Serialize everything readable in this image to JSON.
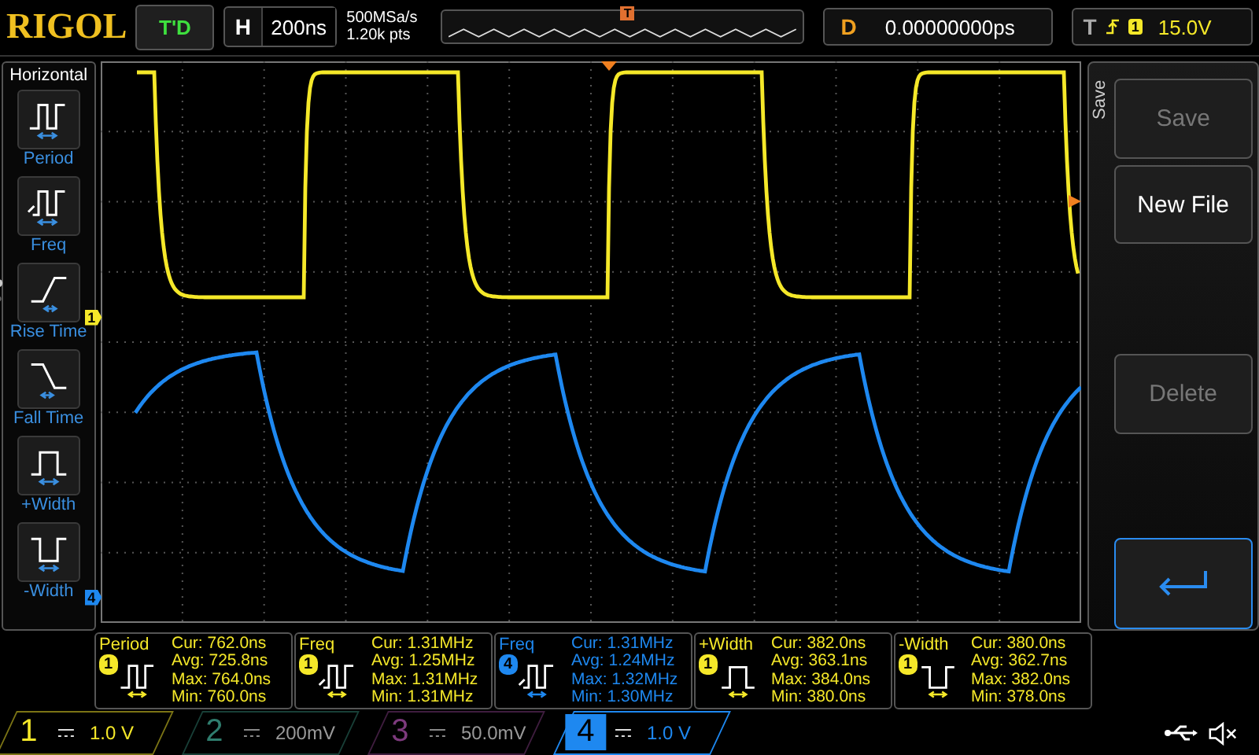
{
  "header": {
    "logo": "RIGOL",
    "run_status": "T'D",
    "horizontal": {
      "label": "H",
      "value": "200ns"
    },
    "sample_rate": "500MSa/s",
    "memory_depth": "1.20k pts",
    "overview_marker": "T",
    "delay": {
      "label": "D",
      "value": "0.00000000ps"
    },
    "trigger": {
      "label": "T",
      "source": "1",
      "level": "15.0V"
    }
  },
  "menu": {
    "title": "Horizontal",
    "items": [
      {
        "kind": "period",
        "label": "Period"
      },
      {
        "kind": "freq",
        "label": "Freq"
      },
      {
        "kind": "rise",
        "label": "Rise Time"
      },
      {
        "kind": "fall",
        "label": "Fall Time"
      },
      {
        "kind": "pwidth",
        "label": "+Width"
      },
      {
        "kind": "nwidth",
        "label": "-Width"
      }
    ]
  },
  "channel_markers": [
    {
      "label": "1",
      "color": "#f5e829"
    },
    {
      "label": "4",
      "color": "#1e88f0"
    }
  ],
  "side_panel": {
    "title": "Save",
    "buttons": [
      {
        "label": "Save",
        "disabled": true
      },
      {
        "label": "New File",
        "disabled": false
      },
      {
        "label": "Delete",
        "disabled": true
      }
    ]
  },
  "measurements": [
    {
      "name": "Period",
      "kind": "period",
      "channel": "1",
      "color": "#f5e829",
      "rows": [
        "Cur: 762.0ns",
        "Avg: 725.8ns",
        "Max: 764.0ns",
        "Min: 760.0ns"
      ]
    },
    {
      "name": "Freq",
      "kind": "freq",
      "channel": "1",
      "color": "#f5e829",
      "rows": [
        "Cur: 1.31MHz",
        "Avg: 1.25MHz",
        "Max: 1.31MHz",
        "Min: 1.31MHz"
      ]
    },
    {
      "name": "Freq",
      "kind": "freq",
      "channel": "4",
      "color": "#1e88f0",
      "rows": [
        "Cur: 1.31MHz",
        "Avg: 1.24MHz",
        "Max: 1.32MHz",
        "Min: 1.30MHz"
      ]
    },
    {
      "name": "+Width",
      "kind": "pwidth",
      "channel": "1",
      "color": "#f5e829",
      "rows": [
        "Cur: 382.0ns",
        "Avg: 363.1ns",
        "Max: 384.0ns",
        "Min: 380.0ns"
      ]
    },
    {
      "name": "-Width",
      "kind": "nwidth",
      "channel": "1",
      "color": "#f5e829",
      "rows": [
        "Cur: 380.0ns",
        "Avg: 362.7ns",
        "Max: 382.0ns",
        "Min: 378.0ns"
      ]
    }
  ],
  "channels": [
    {
      "number": "1",
      "scale": "1.0 V",
      "on": true,
      "selected": false,
      "color": "#f5e829"
    },
    {
      "number": "2",
      "scale": "200mV",
      "on": false,
      "selected": false,
      "color": "#2f7d6e"
    },
    {
      "number": "3",
      "scale": "50.0mV",
      "on": false,
      "selected": false,
      "color": "#7d3a7d"
    },
    {
      "number": "4",
      "scale": "1.0 V",
      "on": true,
      "selected": true,
      "color": "#1e88f0"
    }
  ]
}
